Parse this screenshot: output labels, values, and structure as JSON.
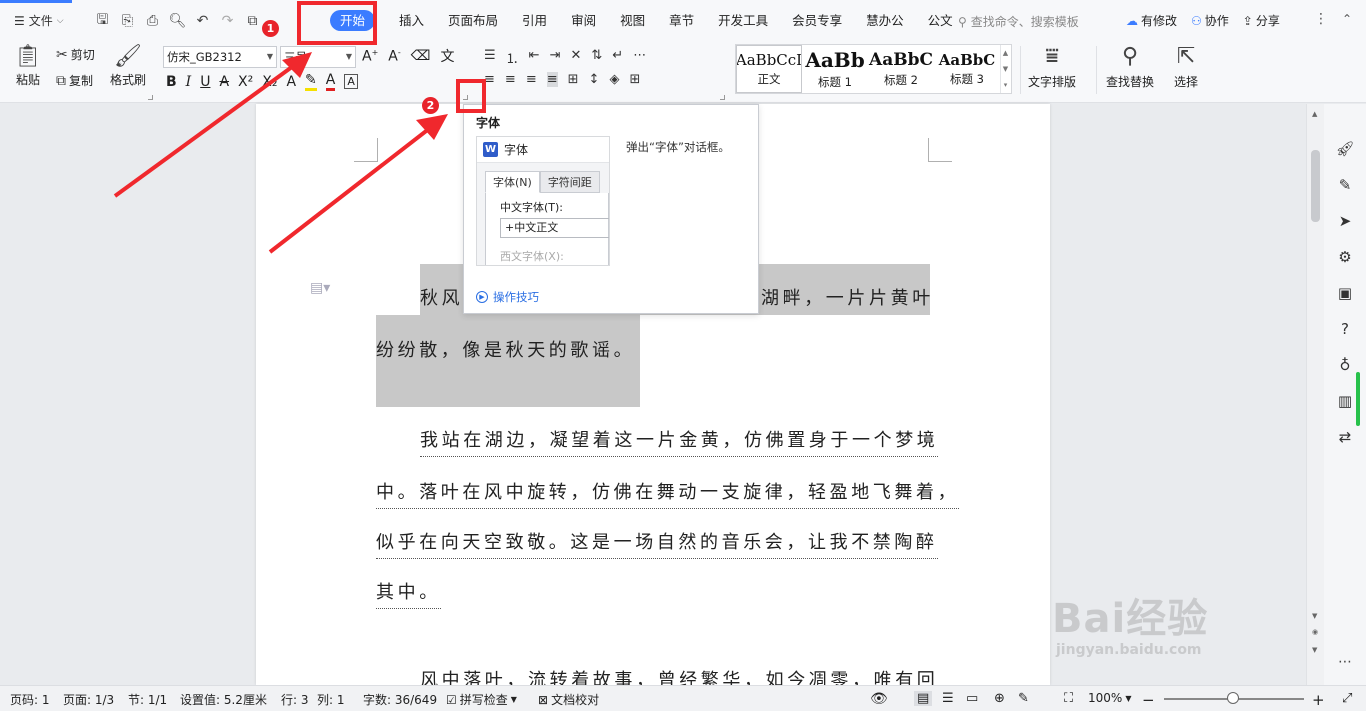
{
  "menubar": {
    "file_label": "文件",
    "tabs": [
      {
        "label": "开始"
      },
      {
        "label": "插入"
      },
      {
        "label": "页面布局"
      },
      {
        "label": "引用"
      },
      {
        "label": "审阅"
      },
      {
        "label": "视图"
      },
      {
        "label": "章节"
      },
      {
        "label": "开发工具"
      },
      {
        "label": "会员专享"
      },
      {
        "label": "慧办公"
      },
      {
        "label": "公文"
      }
    ],
    "search_placeholder": "查找命令、搜索模板",
    "actions": {
      "modify": "有修改",
      "collab": "协作",
      "share": "分享"
    }
  },
  "ribbon": {
    "paste": "粘贴",
    "cut": "剪切",
    "copy": "复制",
    "format_painter": "格式刷",
    "font_name": "仿宋_GB2312",
    "font_size": "三号",
    "styles": [
      {
        "sample": "AaBbCcI",
        "name": "正文"
      },
      {
        "sample": "AaBb",
        "name": "标题 1"
      },
      {
        "sample": "AaBbC",
        "name": "标题 2"
      },
      {
        "sample": "AaBbC",
        "name": "标题 3"
      }
    ],
    "text_layout": "文字排版",
    "find_replace": "查找替换",
    "select": "选择"
  },
  "tooltip": {
    "title": "字体",
    "preview_title": "字体",
    "preview_tab1": "字体(N)",
    "preview_tab2": "字符间距",
    "preview_label1": "中文字体(T):",
    "preview_value1": "+中文正文",
    "preview_label2": "西文字体(X):",
    "description": "弹出“字体”对话框。",
    "link": "操作技巧"
  },
  "document": {
    "lines": [
      "秋风",
      "湖畔，一片片黄叶",
      "纷纷散，像是秋天的歌谣。",
      "我站在湖边，凝望着这一片金黄，仿佛置身于一个梦境",
      "中。落叶在风中旋转，仿佛在舞动一支旋律，轻盈地飞舞着，",
      "似乎在向天空致敬。这是一场自然的音乐会，让我不禁陶醉",
      "其中。",
      "风中落叶，流转着故事，曾经繁华，如今凋零，唯有回"
    ]
  },
  "annotations": {
    "badge1": "1",
    "badge2": "2"
  },
  "statusbar": {
    "page_num": "页码: 1",
    "page": "页面: 1/3",
    "section": "节: 1/1",
    "setting": "设置值: 5.2厘米",
    "row": "行: 3",
    "col": "列: 1",
    "words": "字数: 36/649",
    "spell": "拼写检查",
    "proof": "文档校对",
    "zoom": "100%"
  },
  "watermark": {
    "big": "Bai经验",
    "small": "jingyan.baidu.com"
  },
  "colors": {
    "accent": "#3b7cff",
    "annotation_red": "#f0282d",
    "highlight": "#c8c8c8"
  }
}
